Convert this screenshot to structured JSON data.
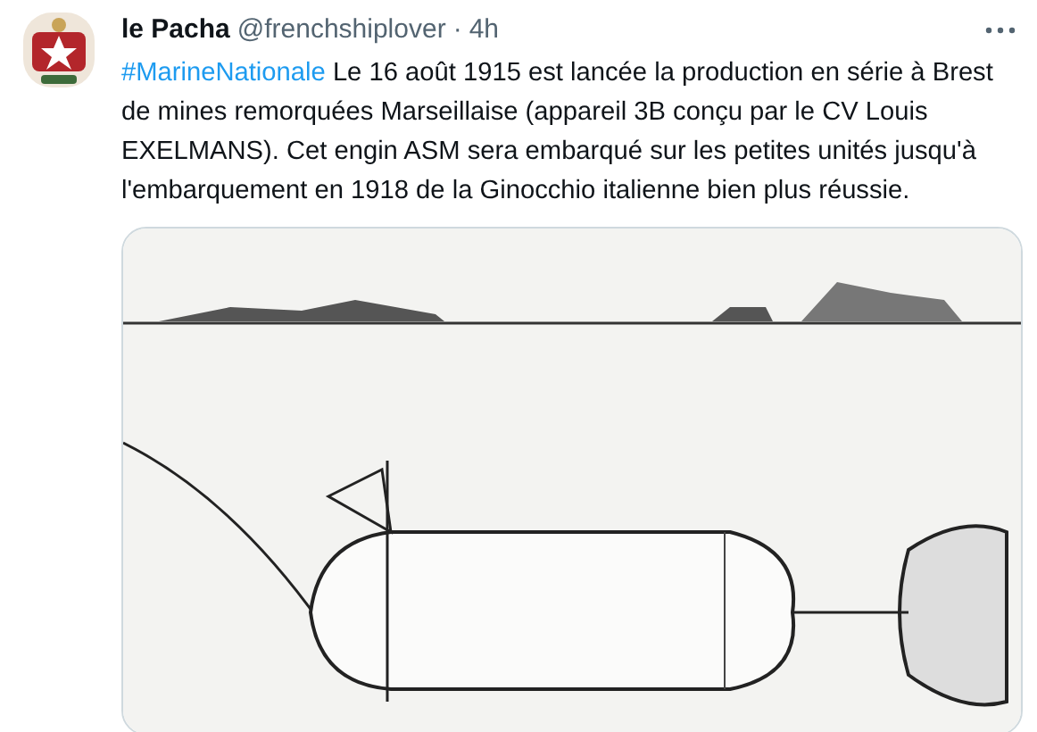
{
  "tweet": {
    "author_name": "le Pacha",
    "handle": "@frenchshiplover",
    "separator": "·",
    "time": "4h",
    "text": {
      "hashtag": "#MarineNationale",
      "body": " Le 16 août 1915 est lancée la production en série à Brest de mines remorquées Marseillaise (appareil 3B conçu par le CV Louis EXELMANS). Cet engin ASM sera embarqué sur les petites unités jusqu'à l'embarquement en 1918 de la Ginocchio italienne bien plus réussie."
    }
  }
}
